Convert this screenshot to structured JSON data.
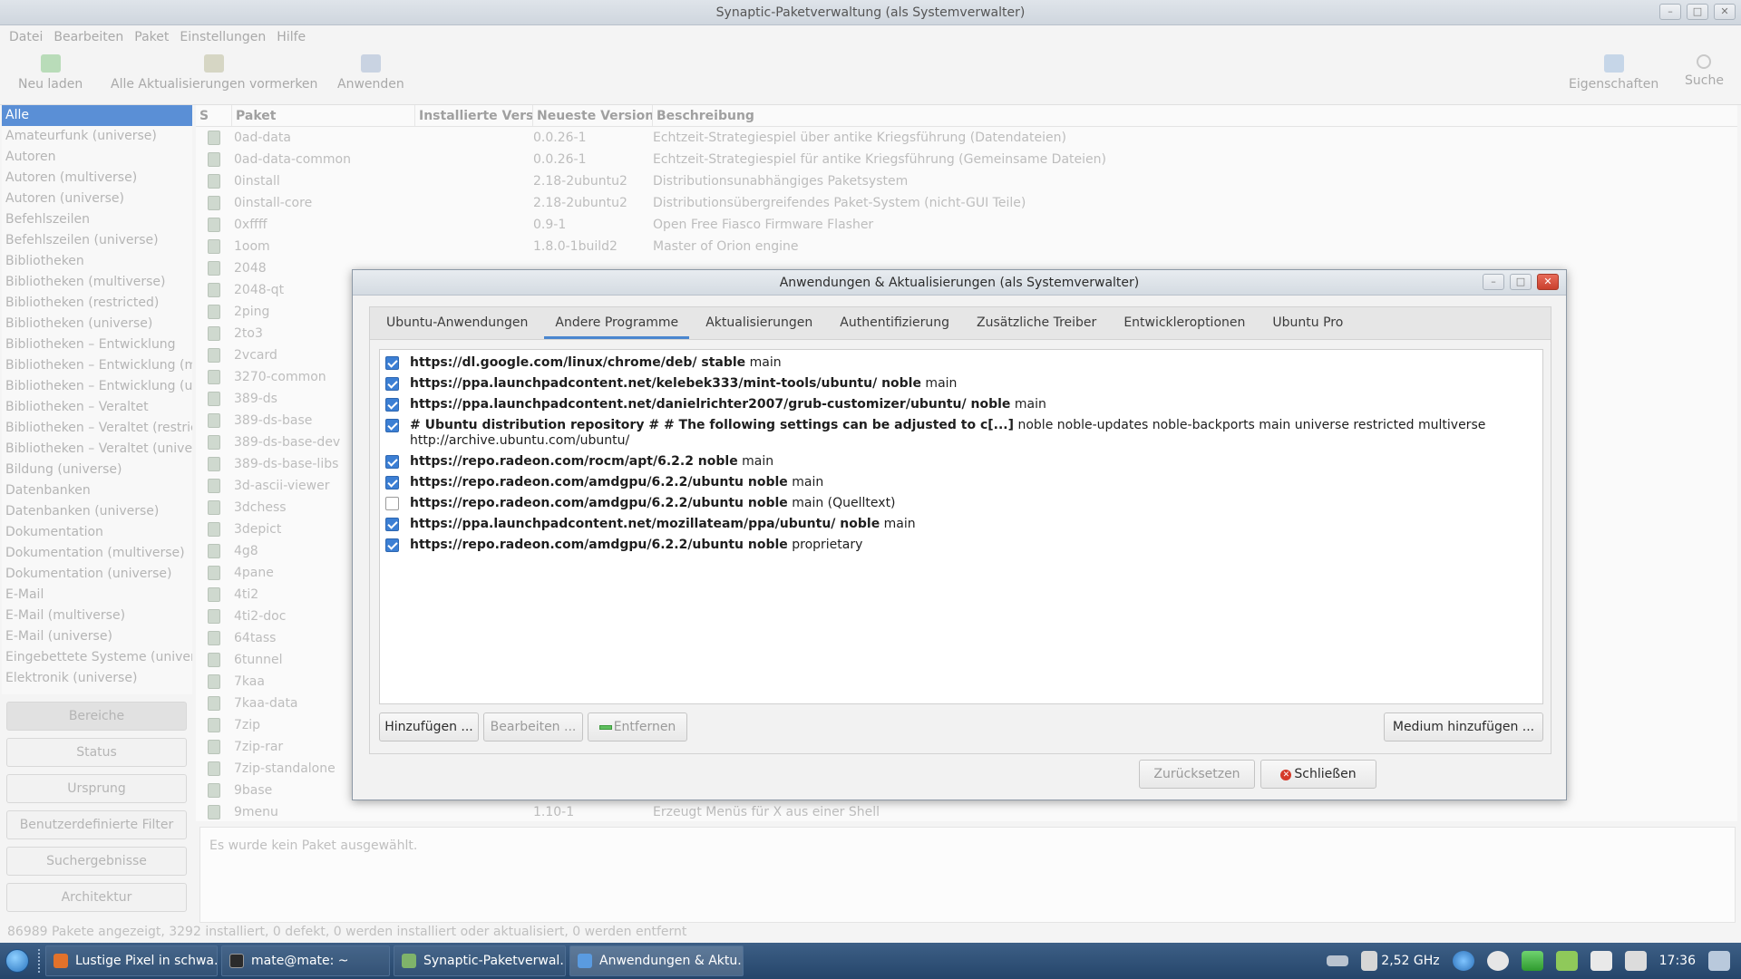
{
  "main_window": {
    "title": "Synaptic-Paketverwaltung  (als Systemverwalter)",
    "menu": [
      "Datei",
      "Bearbeiten",
      "Paket",
      "Einstellungen",
      "Hilfe"
    ],
    "toolbar": {
      "reload": "Neu laden",
      "mark_all": "Alle Aktualisierungen vormerken",
      "apply": "Anwenden",
      "properties": "Eigenschaften",
      "search": "Suche"
    },
    "filters": [
      "Alle",
      "Amateurfunk (universe)",
      "Autoren",
      "Autoren (multiverse)",
      "Autoren (universe)",
      "Befehlszeilen",
      "Befehlszeilen (universe)",
      "Bibliotheken",
      "Bibliotheken (multiverse)",
      "Bibliotheken (restricted)",
      "Bibliotheken (universe)",
      "Bibliotheken – Entwicklung",
      "Bibliotheken – Entwicklung (mu",
      "Bibliotheken – Entwicklung (uni",
      "Bibliotheken – Veraltet",
      "Bibliotheken – Veraltet (restrict",
      "Bibliotheken – Veraltet (univers",
      "Bildung (universe)",
      "Datenbanken",
      "Datenbanken (universe)",
      "Dokumentation",
      "Dokumentation (multiverse)",
      "Dokumentation (universe)",
      "E-Mail",
      "E-Mail (multiverse)",
      "E-Mail (universe)",
      "Eingebettete Systeme (universe",
      "Elektronik (universe)"
    ],
    "side_buttons": [
      "Bereiche",
      "Status",
      "Ursprung",
      "Benutzerdefinierte Filter",
      "Suchergebnisse",
      "Architektur"
    ],
    "columns": [
      "S",
      "Paket",
      "Installierte Version",
      "Neueste Version",
      "Beschreibung"
    ],
    "packages": [
      {
        "name": "0ad-data",
        "version": "0.0.26-1",
        "desc": "Echtzeit-Strategiespiel über antike Kriegsführung (Datendateien)"
      },
      {
        "name": "0ad-data-common",
        "version": "0.0.26-1",
        "desc": "Echtzeit-Strategiespiel für antike Kriegsführung (Gemeinsame Dateien)"
      },
      {
        "name": "0install",
        "version": "2.18-2ubuntu2",
        "desc": "Distributionsunabhängiges Paketsystem"
      },
      {
        "name": "0install-core",
        "version": "2.18-2ubuntu2",
        "desc": "Distributionsübergreifendes Paket-System (nicht-GUI Teile)"
      },
      {
        "name": "0xffff",
        "version": "0.9-1",
        "desc": "Open Free Fiasco Firmware Flasher"
      },
      {
        "name": "1oom",
        "version": "1.8.0-1build2",
        "desc": "Master of Orion engine"
      },
      {
        "name": "2048",
        "version": "",
        "desc": ""
      },
      {
        "name": "2048-qt",
        "version": "",
        "desc": ""
      },
      {
        "name": "2ping",
        "version": "",
        "desc": ""
      },
      {
        "name": "2to3",
        "version": "",
        "desc": ""
      },
      {
        "name": "2vcard",
        "version": "",
        "desc": ""
      },
      {
        "name": "3270-common",
        "version": "",
        "desc": ""
      },
      {
        "name": "389-ds",
        "version": "",
        "desc": ""
      },
      {
        "name": "389-ds-base",
        "version": "",
        "desc": ""
      },
      {
        "name": "389-ds-base-dev",
        "version": "",
        "desc": ""
      },
      {
        "name": "389-ds-base-libs",
        "version": "",
        "desc": ""
      },
      {
        "name": "3d-ascii-viewer",
        "version": "",
        "desc": ""
      },
      {
        "name": "3dchess",
        "version": "",
        "desc": ""
      },
      {
        "name": "3depict",
        "version": "",
        "desc": ""
      },
      {
        "name": "4g8",
        "version": "",
        "desc": ""
      },
      {
        "name": "4pane",
        "version": "",
        "desc": ""
      },
      {
        "name": "4ti2",
        "version": "",
        "desc": ""
      },
      {
        "name": "4ti2-doc",
        "version": "",
        "desc": ""
      },
      {
        "name": "64tass",
        "version": "",
        "desc": ""
      },
      {
        "name": "6tunnel",
        "version": "",
        "desc": ""
      },
      {
        "name": "7kaa",
        "version": "",
        "desc": ""
      },
      {
        "name": "7kaa-data",
        "version": "",
        "desc": ""
      },
      {
        "name": "7zip",
        "version": "",
        "desc": ""
      },
      {
        "name": "7zip-rar",
        "version": "",
        "desc": ""
      },
      {
        "name": "7zip-standalone",
        "version": "",
        "desc": ""
      },
      {
        "name": "9base",
        "version": "",
        "desc": ""
      },
      {
        "name": "9menu",
        "version": "1.10-1",
        "desc": "Erzeugt Menüs für X aus einer Shell"
      }
    ],
    "details_text": "Es wurde kein Paket ausgewählt.",
    "status_text": "86989 Pakete angezeigt, 3292 installiert, 0 defekt, 0 werden installiert oder aktualisiert, 0 werden entfernt"
  },
  "dialog": {
    "title": "Anwendungen & Aktualisierungen (als Systemverwalter)",
    "tabs": [
      "Ubuntu-Anwendungen",
      "Andere Programme",
      "Aktualisierungen",
      "Authentifizierung",
      "Zusätzliche Treiber",
      "Entwickleroptionen",
      "Ubuntu Pro"
    ],
    "sources": [
      {
        "bold": "https://dl.google.com/linux/chrome/deb/ stable",
        "rest": " main",
        "line2": "",
        "checked": true
      },
      {
        "bold": "https://ppa.launchpadcontent.net/kelebek333/mint-tools/ubuntu/ noble",
        "rest": " main",
        "line2": "",
        "checked": true
      },
      {
        "bold": "https://ppa.launchpadcontent.net/danielrichter2007/grub-customizer/ubuntu/ noble",
        "rest": " main",
        "line2": "",
        "checked": true
      },
      {
        "bold": "# Ubuntu distribution repository # # The following settings can be adjusted to c[...]",
        "rest": " noble noble-updates noble-backports main universe restricted multiverse",
        "line2": "http://archive.ubuntu.com/ubuntu/",
        "checked": true
      },
      {
        "bold": "https://repo.radeon.com/rocm/apt/6.2.2 noble",
        "rest": " main",
        "line2": "",
        "checked": true
      },
      {
        "bold": "https://repo.radeon.com/amdgpu/6.2.2/ubuntu noble",
        "rest": " main",
        "line2": "",
        "checked": true
      },
      {
        "bold": "https://repo.radeon.com/amdgpu/6.2.2/ubuntu noble",
        "rest": " main (Quelltext)",
        "line2": "",
        "checked": false
      },
      {
        "bold": "https://ppa.launchpadcontent.net/mozillateam/ppa/ubuntu/ noble",
        "rest": " main",
        "line2": "",
        "checked": true
      },
      {
        "bold": "https://repo.radeon.com/amdgpu/6.2.2/ubuntu noble",
        "rest": " proprietary",
        "line2": "",
        "checked": true
      }
    ],
    "buttons": {
      "add": "Hinzufügen ...",
      "edit": "Bearbeiten ...",
      "remove": "Entfernen",
      "add_media": "Medium hinzufügen ...",
      "reset": "Zurücksetzen",
      "close": "Schließen"
    }
  },
  "taskbar": {
    "tasks": [
      "Lustige Pixel in schwa...",
      "mate@mate: ~",
      "Synaptic-Paketverwal...",
      "Anwendungen & Aktu..."
    ],
    "cpu_freq": "2,52 GHz",
    "clock": "17:36"
  }
}
